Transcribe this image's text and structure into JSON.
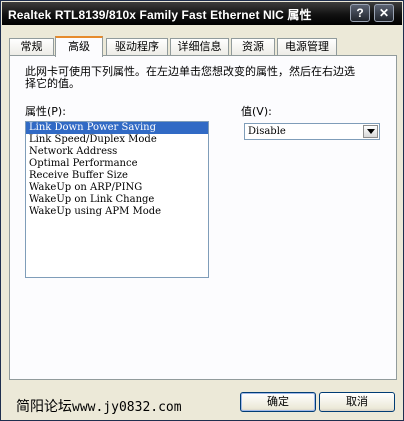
{
  "window": {
    "title": "Realtek RTL8139/810x Family Fast Ethernet NIC 属性",
    "help_label": "?",
    "close_label": "✕"
  },
  "tabs": [
    {
      "label": "常规",
      "active": false
    },
    {
      "label": "高级",
      "active": true
    },
    {
      "label": "驱动程序",
      "active": false
    },
    {
      "label": "详细信息",
      "active": false
    },
    {
      "label": "资源",
      "active": false
    },
    {
      "label": "电源管理",
      "active": false
    }
  ],
  "panel": {
    "description": "此网卡可使用下列属性。在左边单击您想改变的属性，然后在右边选择它的值。",
    "property_label": "属性(P):",
    "value_label": "值(V):",
    "properties": [
      "Link Down Power Saving",
      "Link Speed/Duplex Mode",
      "Network Address",
      "Optimal Performance",
      "Receive Buffer Size",
      "WakeUp on ARP/PING",
      "WakeUp on Link Change",
      "WakeUp using APM Mode"
    ],
    "selected_property": "Link Down Power Saving",
    "value": "Disable"
  },
  "footer": {
    "watermark_cn": "简阳论坛",
    "watermark_url": "www.jy0832.com",
    "ok_label": "确定",
    "cancel_label": "取消"
  }
}
